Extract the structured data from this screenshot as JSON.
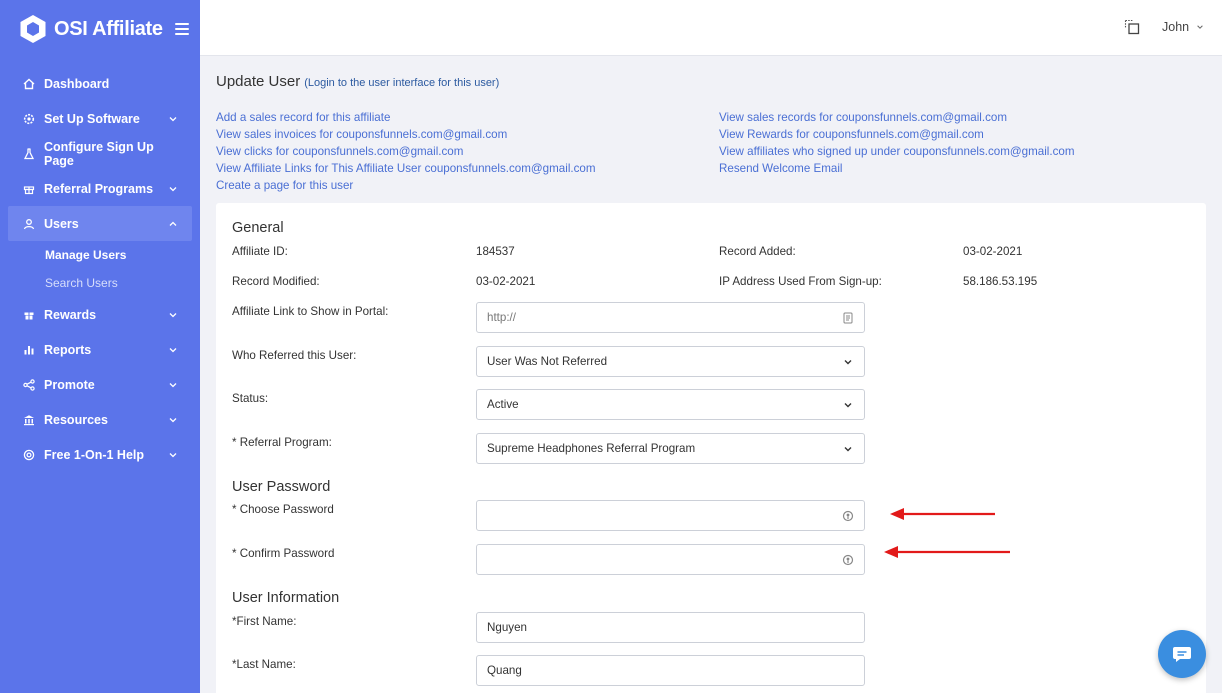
{
  "app": {
    "brand": "OSI Affiliate"
  },
  "colors": {
    "sidebar": "#5b74ea",
    "link": "#4a6fd4",
    "arrow": "#e21a1a",
    "chat": "#3a8ee0"
  },
  "sidebar": {
    "items": [
      {
        "label": "Dashboard",
        "icon": "home-icon"
      },
      {
        "label": "Set Up Software",
        "icon": "gear-icon"
      },
      {
        "label": "Configure Sign Up Page",
        "icon": "flask-icon"
      },
      {
        "label": "Referral Programs",
        "icon": "gift-icon"
      },
      {
        "label": "Users",
        "icon": "user-icon"
      },
      {
        "label": "Rewards",
        "icon": "gift-box-icon"
      },
      {
        "label": "Reports",
        "icon": "bar-chart-icon"
      },
      {
        "label": "Promote",
        "icon": "share-icon"
      },
      {
        "label": "Resources",
        "icon": "bank-icon"
      },
      {
        "label": "Free 1-On-1 Help",
        "icon": "lifebuoy-icon"
      }
    ],
    "users_sub": [
      "Manage Users",
      "Search Users"
    ]
  },
  "topbar": {
    "user": "John"
  },
  "page": {
    "title": "Update User",
    "login_link": "(Login to the user interface for this user)",
    "links_left": [
      "Add a sales record for this affiliate",
      "View sales invoices for couponsfunnels.com@gmail.com",
      "View clicks for couponsfunnels.com@gmail.com",
      "View Affiliate Links for This Affiliate User couponsfunnels.com@gmail.com",
      "Create a page for this user"
    ],
    "links_right": [
      "View sales records for couponsfunnels.com@gmail.com",
      "View Rewards for couponsfunnels.com@gmail.com",
      "View affiliates who signed up under couponsfunnels.com@gmail.com",
      "Resend Welcome Email"
    ]
  },
  "general": {
    "title": "General",
    "affiliate_id_label": "Affiliate ID:",
    "affiliate_id": "184537",
    "record_added_label": "Record Added:",
    "record_added": "03-02-2021",
    "record_modified_label": "Record Modified:",
    "record_modified": "03-02-2021",
    "ip_label": "IP Address Used From Sign-up:",
    "ip": "58.186.53.195",
    "link_label": "Affiliate Link to Show in Portal:",
    "link_placeholder": "http://",
    "referred_label": "Who Referred this User:",
    "referred_value": "User Was Not Referred",
    "status_label": "Status:",
    "status_value": "Active",
    "program_label": "* Referral Program:",
    "program_value": "Supreme Headphones Referral Program"
  },
  "password": {
    "title": "User Password",
    "choose_label": "* Choose Password",
    "confirm_label": "* Confirm Password"
  },
  "user_info": {
    "title": "User Information",
    "first_label": "*First Name:",
    "first_value": "Nguyen",
    "last_label": "*Last Name:",
    "last_value": "Quang"
  }
}
